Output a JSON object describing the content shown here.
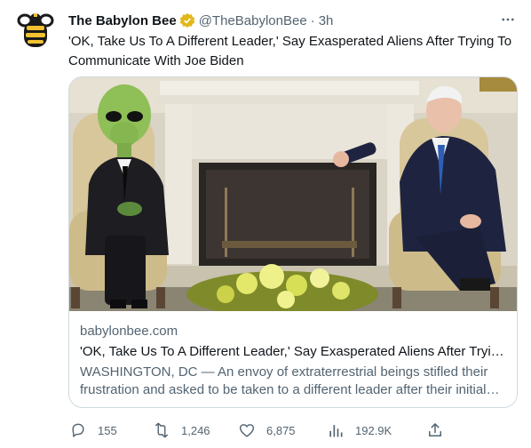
{
  "colors": {
    "text": "#0f1419",
    "secondary": "#536471",
    "border": "#cfd9de",
    "verified_gold": "#e2b719",
    "logo_dark": "#1a1a1a",
    "logo_yellow": "#f2c230"
  },
  "tweet": {
    "author": {
      "display_name": "The Babylon Bee",
      "handle": "@TheBabylonBee",
      "separator": "·",
      "time": "3h",
      "avatar_icon": "babylon-bee-logo",
      "verified_icon": "gold-verified-badge"
    },
    "text": "'OK, Take Us To A Different Leader,' Say Exasperated Aliens After Trying To Communicate With Joe Biden",
    "more_icon": "more-dots-icon"
  },
  "card": {
    "image_alt": "Alien in a suit sitting in a chair across from Joe Biden in the Oval Office",
    "domain": "babylonbee.com",
    "title": "'OK, Take Us To A Different Leader,' Say Exasperated Aliens After Trying To Communicate With Joe Biden",
    "description": "WASHINGTON, DC — An envoy of extraterrestrial beings stifled their frustration and asked to be taken to a different leader after their initial contact with Joe Biden."
  },
  "actions": {
    "replies": "155",
    "retweets": "1,246",
    "likes": "6,875",
    "views": "192.9K",
    "icons": [
      "reply-icon",
      "retweet-icon",
      "like-icon",
      "views-icon",
      "share-icon"
    ]
  }
}
